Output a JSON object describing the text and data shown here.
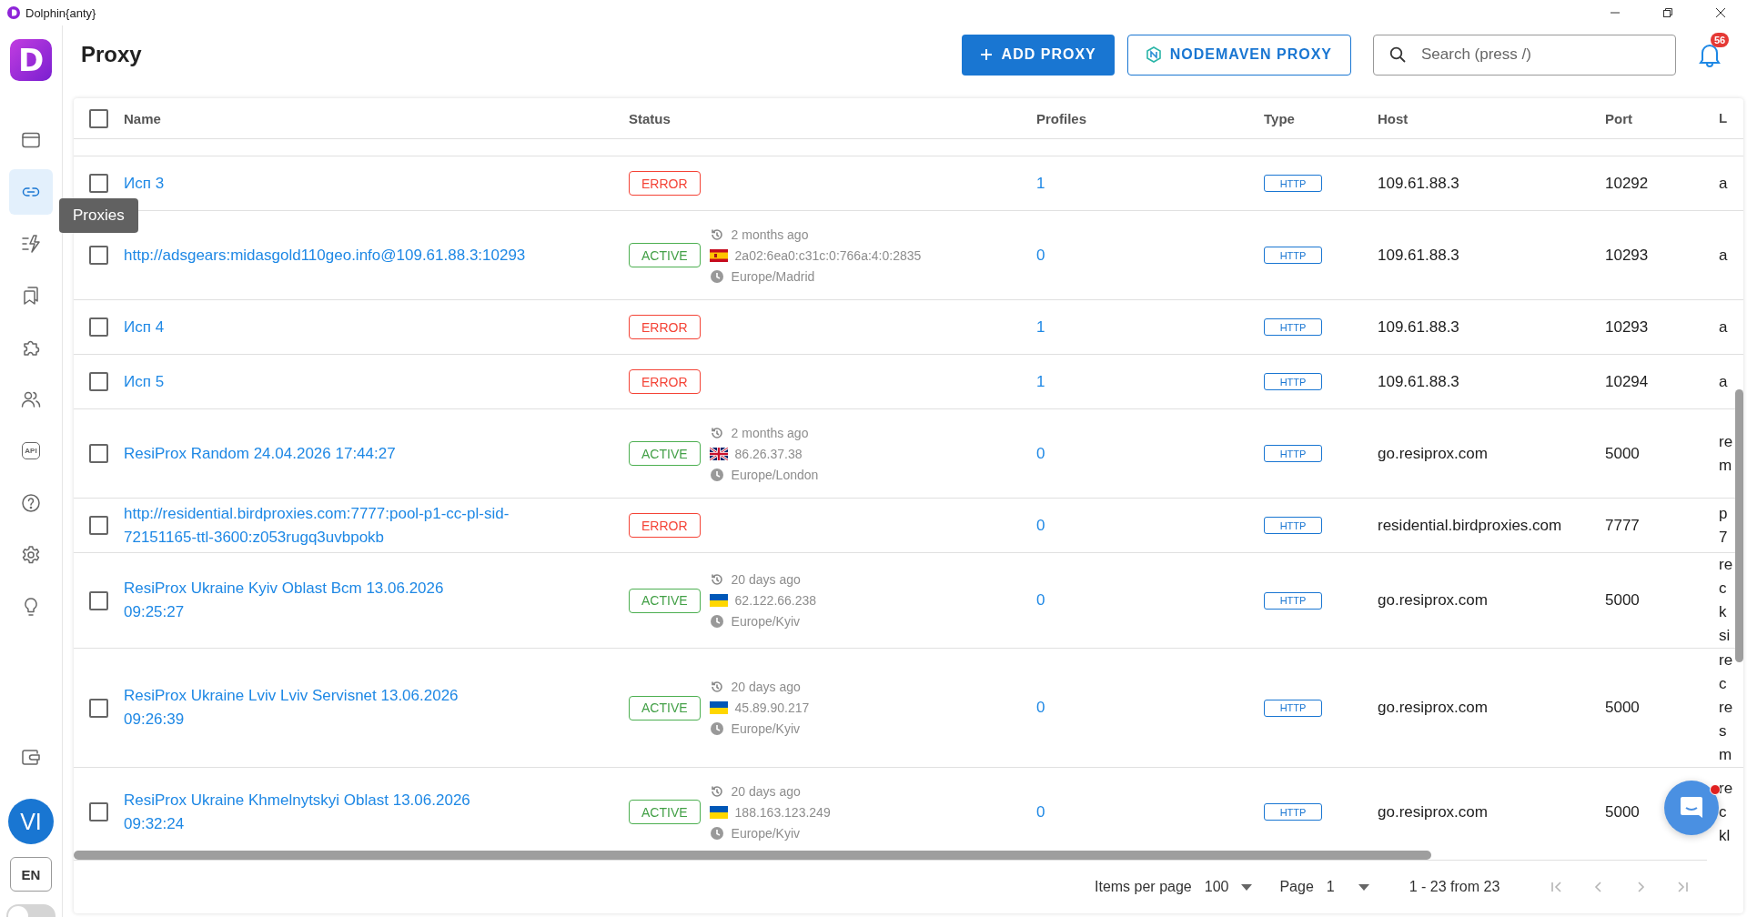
{
  "window": {
    "title": "Dolphin{anty}"
  },
  "sidebar": {
    "logo": "D",
    "items": [
      {
        "selected": false
      },
      {
        "selected": true
      },
      {
        "selected": false
      },
      {
        "selected": false
      },
      {
        "selected": false
      },
      {
        "selected": false
      },
      {
        "selected": false,
        "text": "API"
      },
      {
        "selected": false
      },
      {
        "selected": false
      },
      {
        "selected": false
      },
      {
        "selected": false
      }
    ],
    "tooltip": "Proxies",
    "avatar": "VI",
    "language": "EN",
    "theme_toggle": {
      "on": false
    }
  },
  "header": {
    "title": "Proxy",
    "buttons": [
      {
        "label": "ADD PROXY",
        "kind": "primary"
      },
      {
        "label": "NODEMAVEN PROXY",
        "kind": "outline"
      }
    ],
    "search": {
      "placeholder": "Search (press /)"
    },
    "notifications": "56"
  },
  "table": {
    "select_all": {
      "checked": false
    },
    "columns": [
      "Name",
      "Status",
      "Profiles",
      "Type",
      "Host",
      "Port",
      "L"
    ],
    "rows": [
      {
        "checked": false,
        "name": "Исп 3",
        "status": {
          "kind": "error",
          "label": "ERROR"
        },
        "profiles": "1",
        "type": "HTTP",
        "host": "109.61.88.3",
        "port": "10292",
        "column_7": [
          "a"
        ]
      },
      {
        "checked": false,
        "name": "http://adsgears:midasgold110geo.info@109.61.88.3:10293",
        "status": {
          "kind": "active",
          "label": "ACTIVE"
        },
        "info": {
          "ago": "2 months ago",
          "kind": "es",
          "ip": "2a02:6ea0:c31c:0:766a:4:0:2835",
          "timezone": "Europe/Madrid"
        },
        "profiles": "0",
        "type": "HTTP",
        "host": "109.61.88.3",
        "port": "10293",
        "column_7": [
          "a"
        ]
      },
      {
        "checked": false,
        "name": "Исп 4",
        "status": {
          "kind": "error",
          "label": "ERROR"
        },
        "profiles": "1",
        "type": "HTTP",
        "host": "109.61.88.3",
        "port": "10293",
        "column_7": [
          "a"
        ]
      },
      {
        "checked": false,
        "name": "Исп 5",
        "status": {
          "kind": "error",
          "label": "ERROR"
        },
        "profiles": "1",
        "type": "HTTP",
        "host": "109.61.88.3",
        "port": "10294",
        "column_7": [
          "a"
        ]
      },
      {
        "checked": false,
        "name": "ResiProx Random 24.04.2026 17:44:27",
        "status": {
          "kind": "active",
          "label": "ACTIVE"
        },
        "info": {
          "ago": "2 months ago",
          "kind": "gb",
          "ip": "86.26.37.38",
          "timezone": "Europe/London"
        },
        "profiles": "0",
        "type": "HTTP",
        "host": "go.resiprox.com",
        "port": "5000",
        "column_7": [
          "re",
          "m"
        ]
      },
      {
        "checked": false,
        "name": "http://residential.birdproxies.com:7777:pool-p1-cc-pl-sid-\n72151165-ttl-3600:z053rugq3uvbpokb",
        "status": {
          "kind": "error",
          "label": "ERROR"
        },
        "profiles": "0",
        "type": "HTTP",
        "host": "residential.birdproxies.com",
        "port": "7777",
        "column_7": [
          "p",
          "7"
        ]
      },
      {
        "checked": false,
        "name": "ResiProx Ukraine Kyiv Oblast Всm 13.06.2026\n09:25:27",
        "status": {
          "kind": "active",
          "label": "ACTIVE"
        },
        "info": {
          "ago": "20 days ago",
          "kind": "ua",
          "ip": "62.122.66.238",
          "timezone": "Europe/Kyiv"
        },
        "profiles": "0",
        "type": "HTTP",
        "host": "go.resiprox.com",
        "port": "5000",
        "column_7": [
          "re",
          "c",
          "k",
          "si"
        ]
      },
      {
        "checked": false,
        "name": "ResiProx Ukraine Lviv Lviv Servisnet 13.06.2026\n09:26:39",
        "status": {
          "kind": "active",
          "label": "ACTIVE"
        },
        "info": {
          "ago": "20 days ago",
          "kind": "ua",
          "ip": "45.89.90.217",
          "timezone": "Europe/Kyiv"
        },
        "profiles": "0",
        "type": "HTTP",
        "host": "go.resiprox.com",
        "port": "5000",
        "column_7": [
          "re",
          "c",
          "re",
          "s",
          "m"
        ]
      },
      {
        "checked": false,
        "name": "ResiProx Ukraine Khmelnytskyi Oblast 13.06.2026\n09:32:24",
        "status": {
          "kind": "active",
          "label": "ACTIVE"
        },
        "info": {
          "ago": "20 days ago",
          "kind": "ua",
          "ip": "188.163.123.249",
          "timezone": "Europe/Kyiv"
        },
        "profiles": "0",
        "type": "HTTP",
        "host": "go.resiprox.com",
        "port": "5000",
        "column_7": [
          "re",
          "c",
          "kl"
        ]
      }
    ]
  },
  "pagination": {
    "items_per_page_label": "Items per page",
    "items_per_page": "100",
    "page_label": "Page",
    "page": "1",
    "range": "1 - 23 from 23",
    "nav": [
      {
        "kind": "first",
        "disabled": true
      },
      {
        "kind": "prev",
        "disabled": true
      },
      {
        "kind": "next",
        "disabled": true
      },
      {
        "kind": "last",
        "disabled": true
      }
    ]
  }
}
